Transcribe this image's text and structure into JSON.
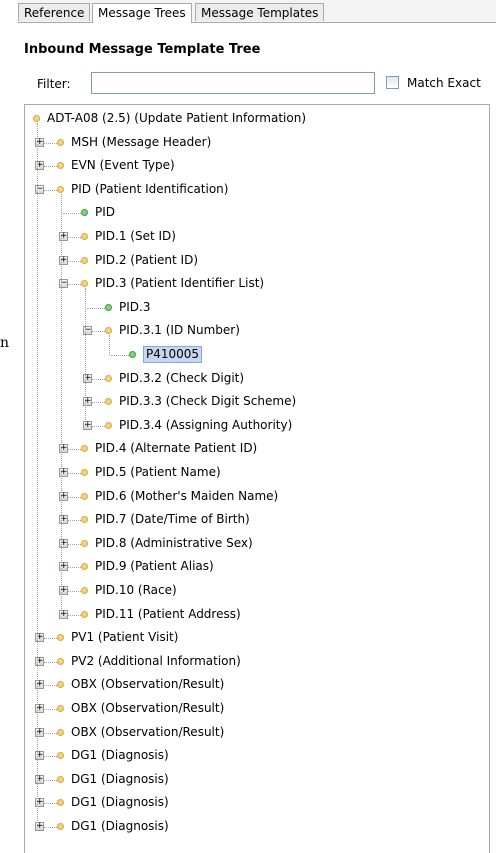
{
  "tabs": [
    "Reference",
    "Message Trees",
    "Message Templates"
  ],
  "header": "Inbound Message Template Tree",
  "filter": {
    "label": "Filter:",
    "value": "",
    "match_exact_label": "Match Exact",
    "match_exact": false
  },
  "stray_text": "n",
  "tree": [
    {
      "label": "ADT-A08 (2.5) (Update Patient Information)",
      "level": 0,
      "type": "folder",
      "expander": "none"
    },
    {
      "label": "MSH (Message Header)",
      "level": 1,
      "type": "folder",
      "expander": "plus"
    },
    {
      "label": "EVN (Event Type)",
      "level": 1,
      "type": "folder",
      "expander": "plus"
    },
    {
      "label": "PID (Patient Identification)",
      "level": 1,
      "type": "folder",
      "expander": "minus"
    },
    {
      "label": "PID",
      "level": 2,
      "type": "leaf",
      "expander": "none"
    },
    {
      "label": "PID.1 (Set ID)",
      "level": 2,
      "type": "folder",
      "expander": "plus"
    },
    {
      "label": "PID.2 (Patient ID)",
      "level": 2,
      "type": "folder",
      "expander": "plus"
    },
    {
      "label": "PID.3 (Patient Identifier List)",
      "level": 2,
      "type": "folder",
      "expander": "minus"
    },
    {
      "label": "PID.3",
      "level": 3,
      "type": "leaf",
      "expander": "none"
    },
    {
      "label": "PID.3.1 (ID Number)",
      "level": 3,
      "type": "folder",
      "expander": "minus"
    },
    {
      "label": "P410005",
      "level": 4,
      "type": "leaf",
      "expander": "none",
      "selected": true
    },
    {
      "label": "PID.3.2 (Check Digit)",
      "level": 3,
      "type": "folder",
      "expander": "plus"
    },
    {
      "label": "PID.3.3 (Check Digit Scheme)",
      "level": 3,
      "type": "folder",
      "expander": "plus"
    },
    {
      "label": "PID.3.4 (Assigning Authority)",
      "level": 3,
      "type": "folder",
      "expander": "plus"
    },
    {
      "label": "PID.4 (Alternate Patient ID)",
      "level": 2,
      "type": "folder",
      "expander": "plus"
    },
    {
      "label": "PID.5 (Patient Name)",
      "level": 2,
      "type": "folder",
      "expander": "plus"
    },
    {
      "label": "PID.6 (Mother's Maiden Name)",
      "level": 2,
      "type": "folder",
      "expander": "plus"
    },
    {
      "label": "PID.7 (Date/Time of Birth)",
      "level": 2,
      "type": "folder",
      "expander": "plus"
    },
    {
      "label": "PID.8 (Administrative Sex)",
      "level": 2,
      "type": "folder",
      "expander": "plus"
    },
    {
      "label": "PID.9 (Patient Alias)",
      "level": 2,
      "type": "folder",
      "expander": "plus"
    },
    {
      "label": "PID.10 (Race)",
      "level": 2,
      "type": "folder",
      "expander": "plus"
    },
    {
      "label": "PID.11 (Patient Address)",
      "level": 2,
      "type": "folder",
      "expander": "plus"
    },
    {
      "label": "PV1 (Patient Visit)",
      "level": 1,
      "type": "folder",
      "expander": "plus"
    },
    {
      "label": "PV2 (Additional Information)",
      "level": 1,
      "type": "folder",
      "expander": "plus"
    },
    {
      "label": "OBX (Observation/Result)",
      "level": 1,
      "type": "folder",
      "expander": "plus"
    },
    {
      "label": "OBX (Observation/Result)",
      "level": 1,
      "type": "folder",
      "expander": "plus"
    },
    {
      "label": "OBX (Observation/Result)",
      "level": 1,
      "type": "folder",
      "expander": "plus"
    },
    {
      "label": "DG1 (Diagnosis)",
      "level": 1,
      "type": "folder",
      "expander": "plus"
    },
    {
      "label": "DG1 (Diagnosis)",
      "level": 1,
      "type": "folder",
      "expander": "plus"
    },
    {
      "label": "DG1 (Diagnosis)",
      "level": 1,
      "type": "folder",
      "expander": "plus"
    },
    {
      "label": "DG1 (Diagnosis)",
      "level": 1,
      "type": "folder",
      "expander": "plus"
    }
  ],
  "colors": {
    "folder_node": "#f4d37a",
    "leaf_node": "#7fd07f",
    "selection": "#c5d7f1"
  }
}
